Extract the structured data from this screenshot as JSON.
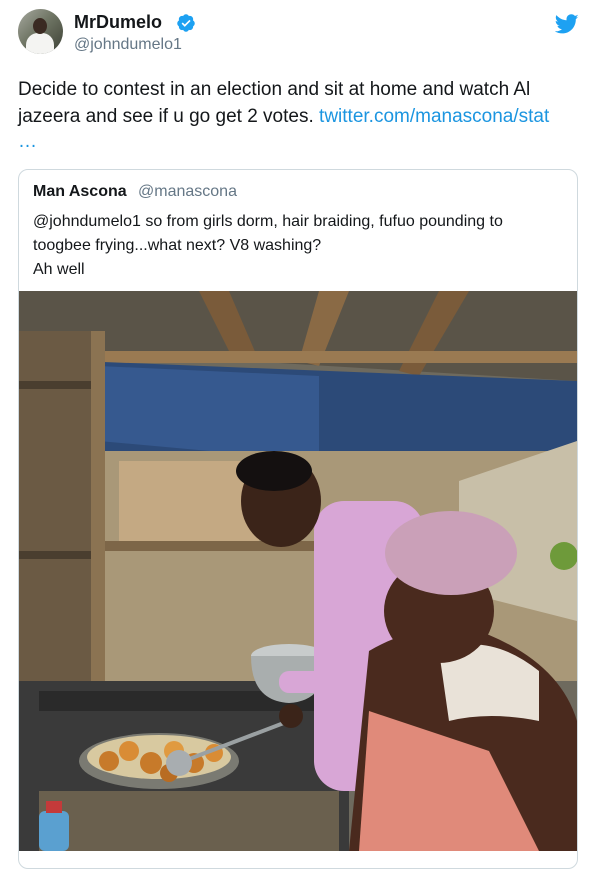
{
  "author": {
    "display_name": "MrDumelo",
    "handle": "@johndumelo1",
    "verified": true
  },
  "tweet": {
    "text_part1": "Decide to contest in an election and sit at home and watch Al jazeera and see if u go get 2 votes.",
    "link_text": "twitter.com/manascona/stat",
    "ellipsis": "…"
  },
  "quoted_tweet": {
    "display_name": "Man Ascona",
    "handle": "@manascona",
    "text_line1": "@johndumelo1 so from girls dorm, hair braiding, fufuo pounding to",
    "text_line2": "toogbee frying...what next? V8 washing?",
    "text_line3": "Ah well"
  },
  "icons": {
    "verified": "verified-badge-icon",
    "platform": "twitter-bird-icon"
  },
  "colors": {
    "link": "#1b95e0",
    "verified": "#1da1f2",
    "secondary_text": "#657786"
  }
}
